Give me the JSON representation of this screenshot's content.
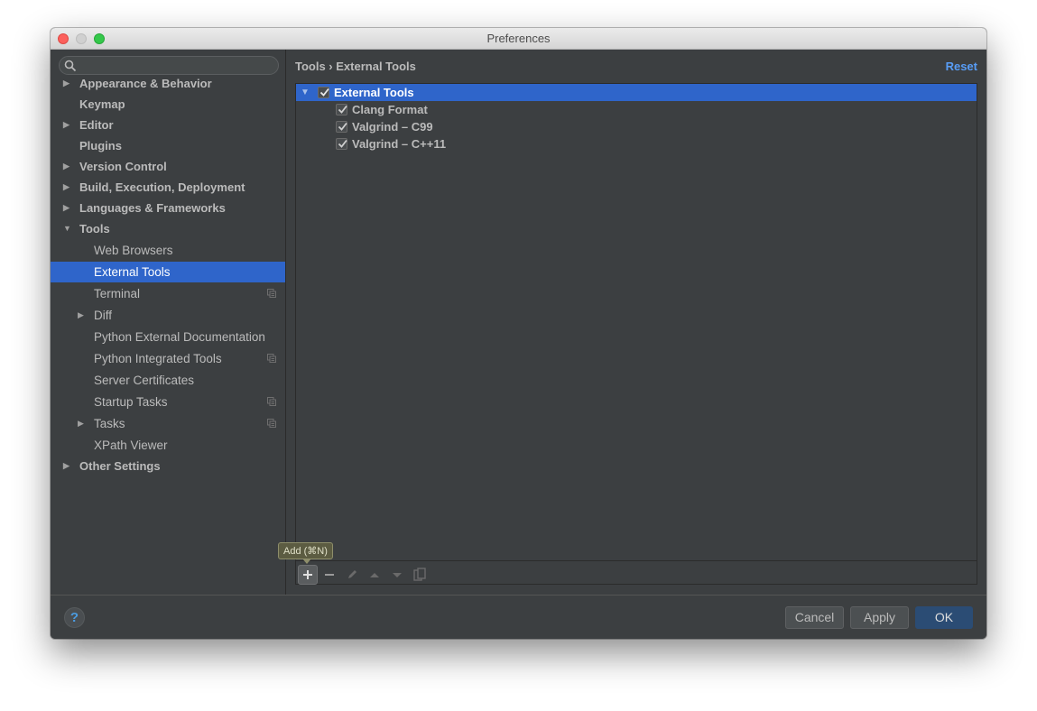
{
  "window": {
    "title": "Preferences"
  },
  "sidebar": {
    "search": {
      "placeholder": "",
      "value": ""
    },
    "items": [
      {
        "label": "Appearance & Behavior",
        "level": 0,
        "expander": "collapsed"
      },
      {
        "label": "Keymap",
        "level": 0,
        "expander": "none"
      },
      {
        "label": "Editor",
        "level": 0,
        "expander": "collapsed"
      },
      {
        "label": "Plugins",
        "level": 0,
        "expander": "none"
      },
      {
        "label": "Version Control",
        "level": 0,
        "expander": "collapsed"
      },
      {
        "label": "Build, Execution, Deployment",
        "level": 0,
        "expander": "collapsed"
      },
      {
        "label": "Languages & Frameworks",
        "level": 0,
        "expander": "collapsed"
      },
      {
        "label": "Tools",
        "level": 0,
        "expander": "expanded"
      },
      {
        "label": "Web Browsers",
        "level": 1,
        "expander": "none"
      },
      {
        "label": "External Tools",
        "level": 1,
        "expander": "none",
        "selected": true
      },
      {
        "label": "Terminal",
        "level": 1,
        "expander": "none",
        "project_icon": true
      },
      {
        "label": "Diff",
        "level": 1,
        "expander": "collapsed"
      },
      {
        "label": "Python External Documentation",
        "level": 1,
        "expander": "none"
      },
      {
        "label": "Python Integrated Tools",
        "level": 1,
        "expander": "none",
        "project_icon": true
      },
      {
        "label": "Server Certificates",
        "level": 1,
        "expander": "none"
      },
      {
        "label": "Startup Tasks",
        "level": 1,
        "expander": "none",
        "project_icon": true
      },
      {
        "label": "Tasks",
        "level": 1,
        "expander": "collapsed",
        "project_icon": true
      },
      {
        "label": "XPath Viewer",
        "level": 1,
        "expander": "none"
      },
      {
        "label": "Other Settings",
        "level": 0,
        "expander": "collapsed"
      }
    ]
  },
  "content": {
    "breadcrumb": "Tools › External Tools",
    "reset_label": "Reset",
    "tools_tree": {
      "root": {
        "label": "External Tools",
        "checked": true,
        "expanded": true
      },
      "children": [
        {
          "label": "Clang Format",
          "checked": true
        },
        {
          "label": "Valgrind – C99",
          "checked": true
        },
        {
          "label": "Valgrind – C++11",
          "checked": true
        }
      ]
    },
    "toolbar": {
      "add_tooltip": "Add (⌘N)",
      "buttons": [
        "add-icon",
        "remove-icon",
        "edit-icon",
        "move-up-icon",
        "move-down-icon",
        "copy-icon"
      ]
    }
  },
  "footer": {
    "help_label": "?",
    "cancel_label": "Cancel",
    "apply_label": "Apply",
    "ok_label": "OK"
  },
  "colors": {
    "selection": "#2f65ca",
    "link": "#589df6",
    "background": "#3c3f41",
    "ok_button": "#2b4c74"
  }
}
